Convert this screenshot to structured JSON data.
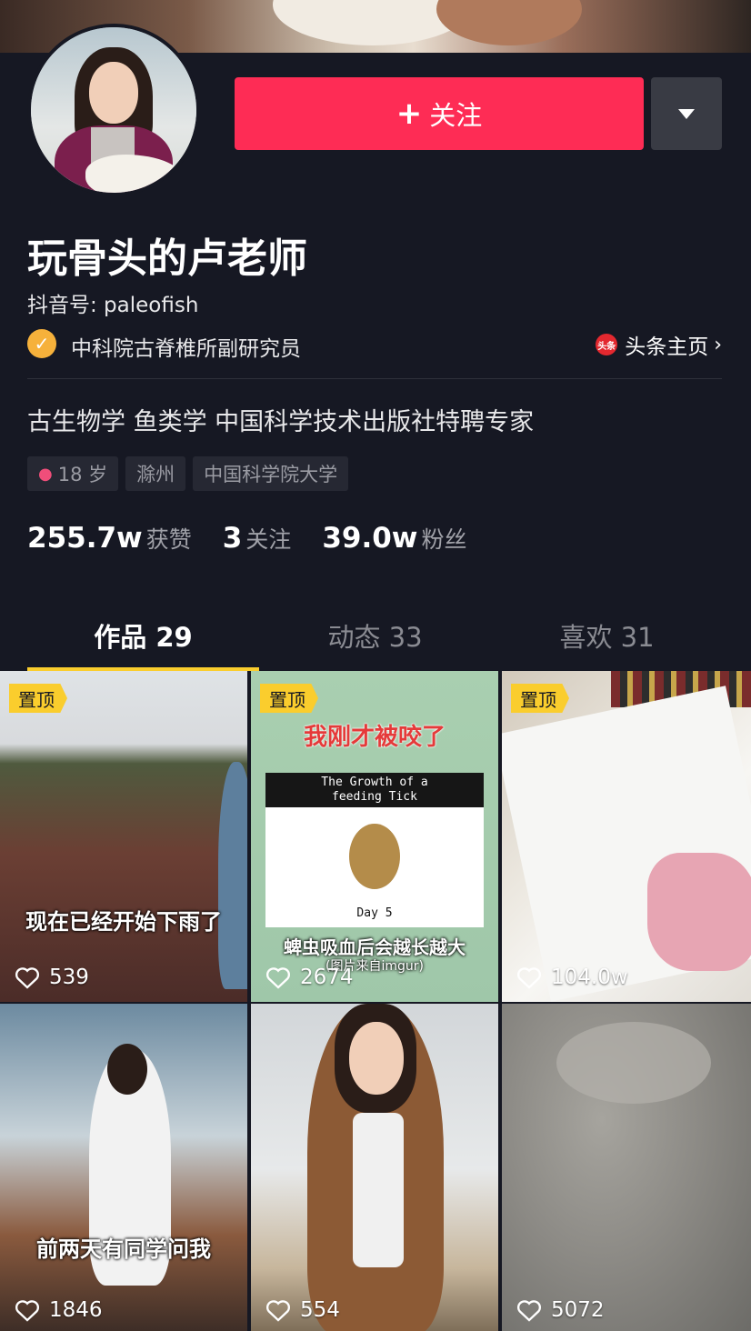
{
  "header": {
    "follow_plus": "+",
    "follow_label": "关注"
  },
  "profile": {
    "name": "玩骨头的卢老师",
    "douyin_id": "抖音号: paleofish",
    "verification": "中科院古脊椎所副研究员",
    "toutiao_icon": "头条",
    "toutiao_link": "头条主页",
    "bio": "古生物学 鱼类学 中国科学技术出版社特聘专家",
    "tags": [
      {
        "label": "18 岁",
        "icon": "female-icon"
      },
      {
        "label": "滁州"
      },
      {
        "label": "中国科学院大学"
      }
    ]
  },
  "stats": [
    {
      "num": "255.7w",
      "label": "获赞"
    },
    {
      "num": "3",
      "label": "关注"
    },
    {
      "num": "39.0w",
      "label": "粉丝"
    }
  ],
  "tabs": [
    {
      "label": "作品 29",
      "active": true
    },
    {
      "label": "动态 33",
      "active": false
    },
    {
      "label": "喜欢 31",
      "active": false
    }
  ],
  "videos": [
    {
      "pinned": "置顶",
      "likes": "539",
      "caption": "现在已经开始下雨了"
    },
    {
      "pinned": "置顶",
      "likes": "2674",
      "caption_top": "我刚才被咬了",
      "card_title": "The Growth of a\nfeeding Tick",
      "card_day": "Day 5",
      "caption": "蜱虫吸血后会越长越大",
      "caption_sub": "(图片来自imgur)"
    },
    {
      "pinned": "置顶",
      "likes": "104.0w"
    },
    {
      "likes": "1846",
      "caption": "前两天有同学问我"
    },
    {
      "likes": "554"
    },
    {
      "likes": "5072"
    }
  ],
  "colors": {
    "background": "#161823",
    "follow": "#fe2c55",
    "accent": "#facd2d",
    "verified": "#f6b13b"
  }
}
